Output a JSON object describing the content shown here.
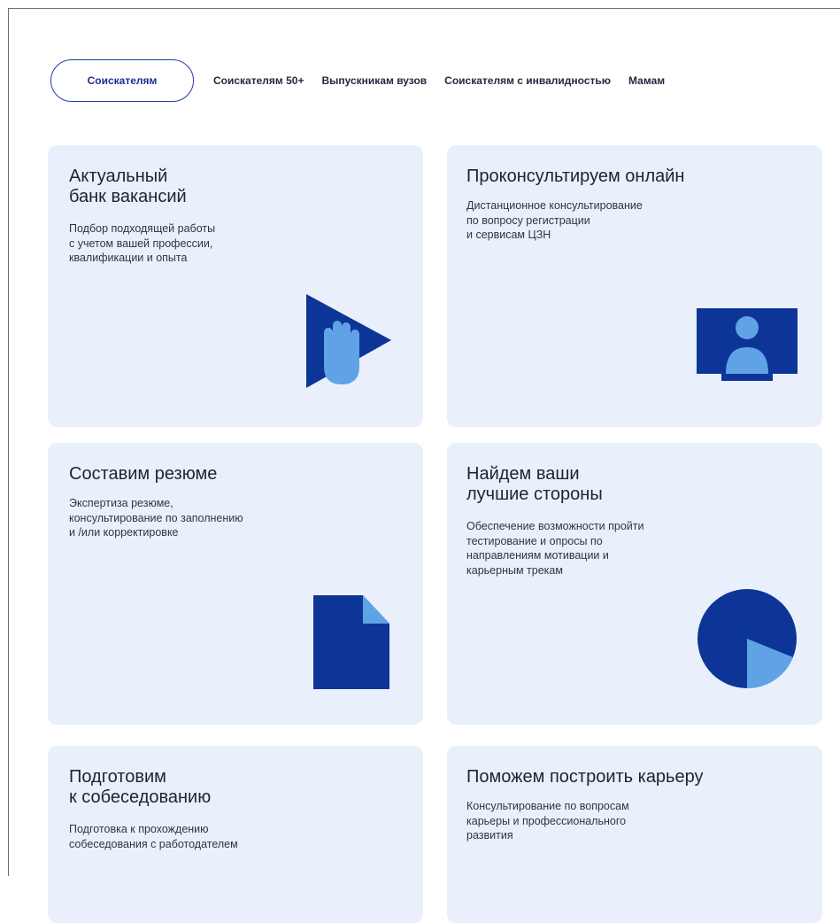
{
  "tabs": [
    {
      "label": "Соискателям",
      "active": true
    },
    {
      "label": "Соискателям 50+"
    },
    {
      "label": "Выпускникам вузов"
    },
    {
      "label": "Соискателям с инвалидностью"
    },
    {
      "label": "Мамам"
    }
  ],
  "cards": [
    {
      "title_l1": "Актуальный",
      "title_l2": "банк вакансий",
      "desc_l1": "Подбор подходящей работы",
      "desc_l2": "с учетом вашей профессии,",
      "desc_l3": "квалификации и опыта",
      "icon": "play-hand-icon"
    },
    {
      "title_l1": "Проконсультируем онлайн",
      "desc_l1": "Дистанционное консультирование",
      "desc_l2": "по вопросу регистрации",
      "desc_l3": "и сервисам ЦЗН",
      "icon": "monitor-user-icon"
    },
    {
      "title_l1": "Составим резюме",
      "desc_l1": "Экспертиза резюме,",
      "desc_l2": "консультирование по заполнению",
      "desc_l3": "и /или корректировке",
      "icon": "document-icon"
    },
    {
      "title_l1": "Найдем ваши",
      "title_l2": "лучшие стороны",
      "desc_l1": "Обеспечение возможности пройти",
      "desc_l2": "тестирование и опросы по",
      "desc_l3": "направлениям мотивации и",
      "desc_l4": "карьерным трекам",
      "icon": "pie-chart-icon"
    },
    {
      "title_l1": "Подготовим",
      "title_l2": "к собеседованию",
      "desc_l1": "Подготовка к прохождению",
      "desc_l2": "собеседования с работодателем",
      "icon": "interview-icon"
    },
    {
      "title_l1": "Поможем построить карьеру",
      "desc_l1": "Консультирование по вопросам",
      "desc_l2": "карьеры и профессионального",
      "desc_l3": "развития",
      "icon": "career-icon"
    }
  ],
  "colors": {
    "card_bg": "#e9f0fb",
    "dark_blue": "#0d3597",
    "light_blue": "#5fa3e6",
    "tab_border": "#1f3fa0"
  }
}
